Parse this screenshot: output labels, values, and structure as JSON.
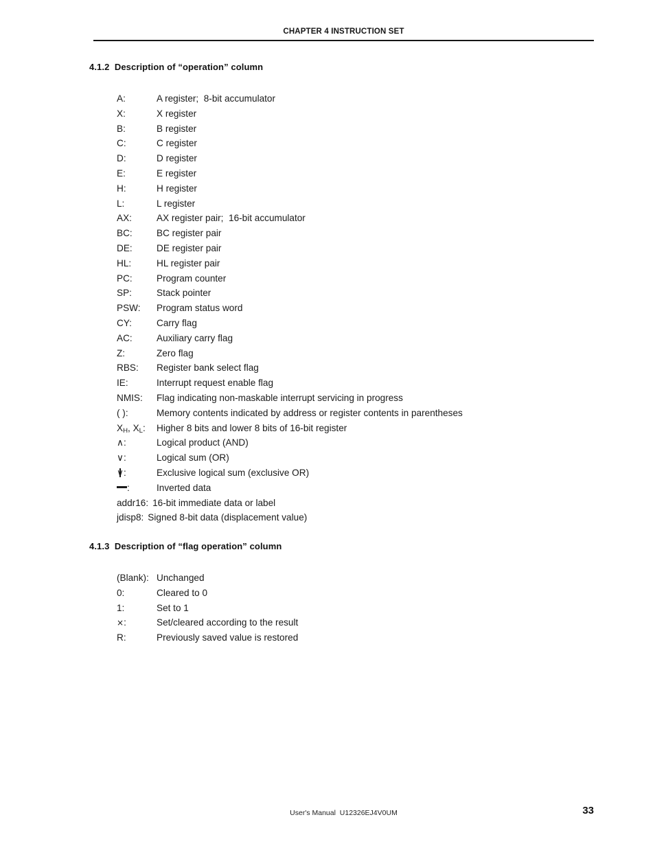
{
  "running_head": "CHAPTER 4  INSTRUCTION SET",
  "sections": {
    "operation": {
      "heading": "4.1.2  Description of “operation” column",
      "entries": [
        {
          "term": "A:",
          "desc": "A register;  8-bit accumulator"
        },
        {
          "term": "X:",
          "desc": "X register"
        },
        {
          "term": "B:",
          "desc": "B register"
        },
        {
          "term": "C:",
          "desc": "C register"
        },
        {
          "term": "D:",
          "desc": "D register"
        },
        {
          "term": "E:",
          "desc": "E register"
        },
        {
          "term": "H:",
          "desc": "H register"
        },
        {
          "term": "L:",
          "desc": "L register"
        },
        {
          "term": "AX:",
          "desc": "AX register pair;  16-bit accumulator"
        },
        {
          "term": "BC:",
          "desc": "BC register pair"
        },
        {
          "term": "DE:",
          "desc": "DE register pair"
        },
        {
          "term": "HL:",
          "desc": "HL register pair"
        },
        {
          "term": "PC:",
          "desc": "Program counter"
        },
        {
          "term": "SP:",
          "desc": "Stack pointer"
        },
        {
          "term": "PSW:",
          "desc": "Program status word"
        },
        {
          "term": "CY:",
          "desc": "Carry flag"
        },
        {
          "term": "AC:",
          "desc": "Auxiliary carry flag"
        },
        {
          "term": "Z:",
          "desc": "Zero flag"
        },
        {
          "term": "RBS:",
          "desc": "Register bank select flag"
        },
        {
          "term": "IE:",
          "desc": "Interrupt request enable flag"
        },
        {
          "term": "NMIS:",
          "desc": "Flag indicating non-maskable interrupt servicing in progress"
        },
        {
          "term": "( ):",
          "desc": "Memory contents indicated by address or register contents in parentheses"
        },
        {
          "term": "XH, XL:",
          "desc": "Higher 8 bits and lower 8 bits of 16-bit register"
        },
        {
          "term": "∧:",
          "desc": "Logical product (AND)"
        },
        {
          "term": "∨:",
          "desc": "Logical sum (OR)"
        },
        {
          "term": "∨:",
          "desc": "Exclusive logical sum (exclusive OR)"
        },
        {
          "term": "—:",
          "desc": "Inverted data"
        },
        {
          "term": "addr16:",
          "desc": "16-bit immediate data or label"
        },
        {
          "term": "jdisp8:",
          "desc": "Signed 8-bit data (displacement value)"
        }
      ]
    },
    "flag_operation": {
      "heading": "4.1.3  Description of “flag operation” column",
      "entries": [
        {
          "term": "(Blank):",
          "desc": "Unchanged"
        },
        {
          "term": "0:",
          "desc": "Cleared to 0"
        },
        {
          "term": "1:",
          "desc": "Set to 1"
        },
        {
          "term": "×:",
          "desc": "Set/cleared according to the result"
        },
        {
          "term": "R:",
          "desc": "Previously saved value is restored"
        }
      ]
    }
  },
  "footer": {
    "manual": "User's Manual  U12326EJ4V0UM",
    "page_number": "33"
  }
}
